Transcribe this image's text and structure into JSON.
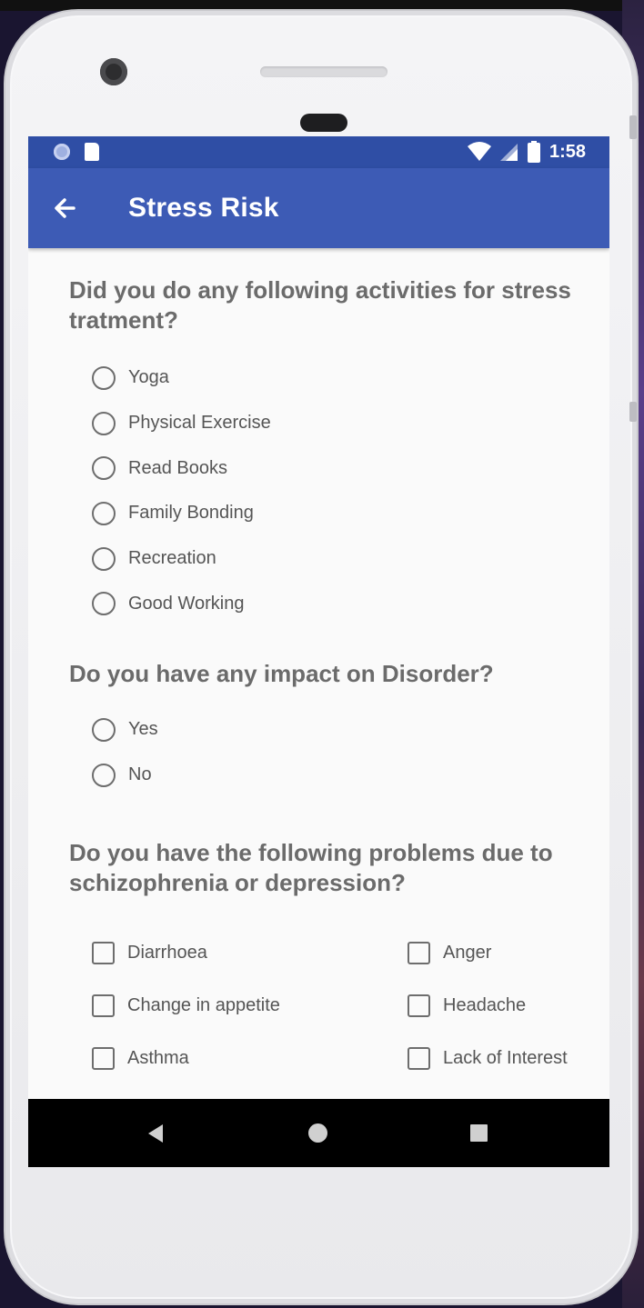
{
  "status_bar": {
    "time": "1:58",
    "left_icons": [
      "circle-icon",
      "sd-card-icon"
    ],
    "right_icons": [
      "wifi-icon",
      "signal-icon",
      "battery-icon"
    ]
  },
  "app_bar": {
    "title": "Stress Risk",
    "nav_icon": "arrow-back-icon"
  },
  "colors": {
    "status_bar": "#2f4ea5",
    "app_bar": "#3d5bb5",
    "background": "#fafafa",
    "text": "#555555"
  },
  "questions": [
    {
      "text": "Did you do any following activities for stress tratment?",
      "type": "radio",
      "options": [
        "Yoga",
        "Physical Exercise",
        "Read Books",
        "Family Bonding",
        "Recreation",
        "Good Working"
      ]
    },
    {
      "text": "Do you have any impact on Disorder?",
      "type": "radio",
      "options": [
        "Yes",
        "No"
      ]
    },
    {
      "text": "Do you have the following problems due to schizophrenia or depression?",
      "type": "checkbox",
      "options": [
        "Diarrhoea",
        "Anger",
        "Change in appetite",
        "Headache",
        "Asthma",
        "Lack of Interest"
      ]
    }
  ],
  "nav_bar": {
    "icons": [
      "back-triangle-icon",
      "home-circle-icon",
      "recents-square-icon"
    ]
  }
}
